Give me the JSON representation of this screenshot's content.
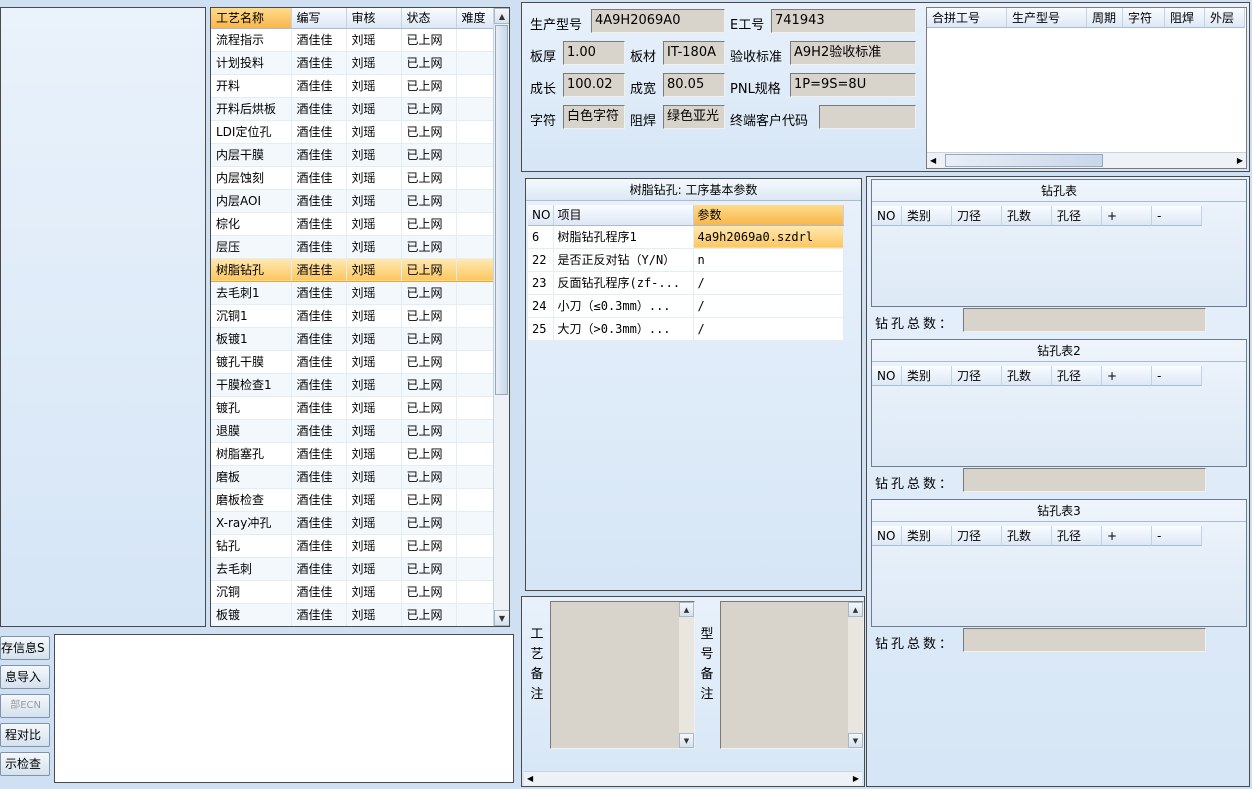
{
  "process_table": {
    "headers": [
      "工艺名称",
      "编写",
      "审核",
      "状态",
      "难度"
    ],
    "rows": [
      [
        "流程指示",
        "酒佳佳",
        "刘瑶",
        "已上网",
        ""
      ],
      [
        "计划投料",
        "酒佳佳",
        "刘瑶",
        "已上网",
        ""
      ],
      [
        "开料",
        "酒佳佳",
        "刘瑶",
        "已上网",
        ""
      ],
      [
        "开料后烘板",
        "酒佳佳",
        "刘瑶",
        "已上网",
        ""
      ],
      [
        "LDI定位孔",
        "酒佳佳",
        "刘瑶",
        "已上网",
        ""
      ],
      [
        "内层干膜",
        "酒佳佳",
        "刘瑶",
        "已上网",
        ""
      ],
      [
        "内层蚀刻",
        "酒佳佳",
        "刘瑶",
        "已上网",
        ""
      ],
      [
        "内层AOI",
        "酒佳佳",
        "刘瑶",
        "已上网",
        ""
      ],
      [
        "棕化",
        "酒佳佳",
        "刘瑶",
        "已上网",
        ""
      ],
      [
        "层压",
        "酒佳佳",
        "刘瑶",
        "已上网",
        ""
      ],
      [
        "树脂钻孔",
        "酒佳佳",
        "刘瑶",
        "已上网",
        ""
      ],
      [
        "去毛刺1",
        "酒佳佳",
        "刘瑶",
        "已上网",
        ""
      ],
      [
        "沉铜1",
        "酒佳佳",
        "刘瑶",
        "已上网",
        ""
      ],
      [
        "板镀1",
        "酒佳佳",
        "刘瑶",
        "已上网",
        ""
      ],
      [
        "镀孔干膜",
        "酒佳佳",
        "刘瑶",
        "已上网",
        ""
      ],
      [
        "干膜检查1",
        "酒佳佳",
        "刘瑶",
        "已上网",
        ""
      ],
      [
        "镀孔",
        "酒佳佳",
        "刘瑶",
        "已上网",
        ""
      ],
      [
        "退膜",
        "酒佳佳",
        "刘瑶",
        "已上网",
        ""
      ],
      [
        "树脂塞孔",
        "酒佳佳",
        "刘瑶",
        "已上网",
        ""
      ],
      [
        "磨板",
        "酒佳佳",
        "刘瑶",
        "已上网",
        ""
      ],
      [
        "磨板检查",
        "酒佳佳",
        "刘瑶",
        "已上网",
        ""
      ],
      [
        "X-ray冲孔",
        "酒佳佳",
        "刘瑶",
        "已上网",
        ""
      ],
      [
        "钻孔",
        "酒佳佳",
        "刘瑶",
        "已上网",
        ""
      ],
      [
        "去毛刺",
        "酒佳佳",
        "刘瑶",
        "已上网",
        ""
      ],
      [
        "沉铜",
        "酒佳佳",
        "刘瑶",
        "已上网",
        ""
      ],
      [
        "板镀",
        "酒佳佳",
        "刘瑶",
        "已上网",
        ""
      ]
    ],
    "selected_index": 10
  },
  "side_buttons": [
    {
      "label": "存信息S",
      "enabled": true
    },
    {
      "label": "息导入",
      "enabled": true
    },
    {
      "label": "部ECN",
      "enabled": false
    },
    {
      "label": "程对比",
      "enabled": true
    },
    {
      "label": "示检查",
      "enabled": true
    }
  ],
  "info": {
    "product_model_label": "生产型号",
    "product_model": "4A9H2069A0",
    "e_number_label": "E工号",
    "e_number": "741943",
    "thickness_label": "板厚",
    "thickness": "1.00",
    "material_label": "板材",
    "material": "IT-180A",
    "acceptance_label": "验收标准",
    "acceptance": "A9H2验收标准",
    "length_label": "成长",
    "length": "100.02",
    "width_label": "成宽",
    "width": "80.05",
    "pnl_label": "PNL规格",
    "pnl": "1P=9S=8U",
    "char_label": "字符",
    "char": "白色字符",
    "solder_label": "阻焊",
    "solder": "绿色亚光",
    "customer_code_label": "终端客户代码",
    "customer_code": ""
  },
  "merge_table": {
    "headers": [
      "合拼工号",
      "生产型号",
      "周期",
      "字符",
      "阻焊",
      "外层"
    ]
  },
  "param_panel": {
    "title": "树脂钻孔: 工序基本参数",
    "headers": [
      "NO",
      "项目",
      "参数"
    ],
    "rows": [
      [
        "6",
        "树脂钻孔程序1",
        "4a9h2069a0.szdrl"
      ],
      [
        "22",
        "是否正反对钻（Y/N）",
        "n"
      ],
      [
        "23",
        "反面钻孔程序(zf-...",
        "/"
      ],
      [
        "24",
        "小刀（≤0.3mm）...",
        "/"
      ],
      [
        "25",
        "大刀（>0.3mm）...",
        "/"
      ]
    ]
  },
  "remarks": {
    "process_note_label": "工艺备注",
    "model_note_label": "型号备注"
  },
  "drill_tables": [
    {
      "title": "钻孔表",
      "count_label": "钻孔总数："
    },
    {
      "title": "钻孔表2",
      "count_label": "钻孔总数："
    },
    {
      "title": "钻孔表3",
      "count_label": "钻孔总数："
    }
  ],
  "drill_headers": [
    "NO",
    "类别",
    "刀径",
    "孔数",
    "孔径",
    "+",
    "-"
  ]
}
